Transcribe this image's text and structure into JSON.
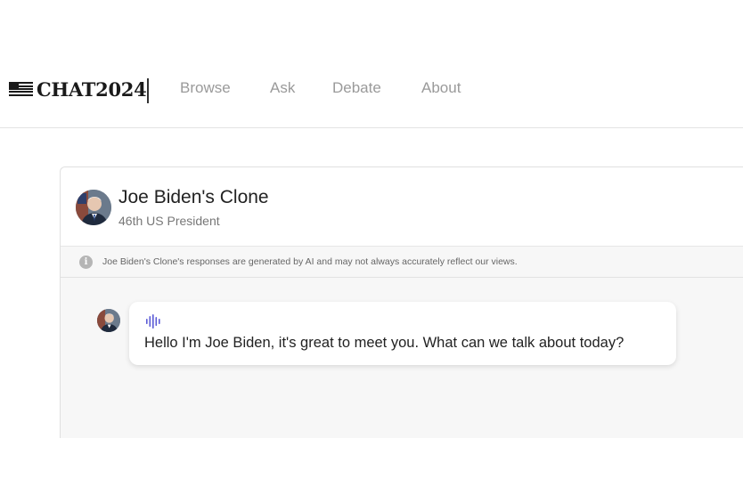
{
  "header": {
    "logo_text": "CHAT2024",
    "nav": [
      {
        "label": "Browse"
      },
      {
        "label": "Ask"
      },
      {
        "label": "Debate"
      },
      {
        "label": "About"
      }
    ]
  },
  "chat": {
    "clone_name": "Joe Biden's Clone",
    "clone_role": "46th US President",
    "notice": "Joe Biden's Clone's responses are generated by AI and may not always accurately reflect our views.",
    "messages": [
      {
        "text": "Hello I'm Joe Biden, it's great to meet you. What can we talk about today?"
      }
    ]
  },
  "icons": {
    "logo": "flag-icon",
    "info": "info-icon",
    "audio": "audio-wave-icon",
    "avatar": "avatar"
  },
  "colors": {
    "accent": "#5b5bd6",
    "nav_text": "#9a9a9a",
    "panel_bg": "#f7f7f7"
  }
}
